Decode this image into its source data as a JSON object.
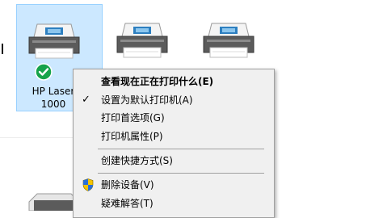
{
  "printers": [
    {
      "label_line1": "HP Laser",
      "label_line2": "1000",
      "selected": true,
      "is_default": true
    },
    {
      "label_line1": "",
      "label_line2": "",
      "selected": false,
      "is_default": false
    },
    {
      "label_line1": "",
      "label_line2": "",
      "selected": false,
      "is_default": false
    }
  ],
  "context_menu": {
    "items": [
      {
        "label": "查看现在正在打印什么(E)",
        "bold": true,
        "checked": false,
        "icon": null
      },
      {
        "label": "设置为默认打印机(A)",
        "bold": false,
        "checked": true,
        "icon": null
      },
      {
        "label": "打印首选项(G)",
        "bold": false,
        "checked": false,
        "icon": null
      },
      {
        "label": "打印机属性(P)",
        "bold": false,
        "checked": false,
        "icon": null
      },
      {
        "label": "创建快捷方式(S)",
        "bold": false,
        "checked": false,
        "icon": null
      },
      {
        "label": "删除设备(V)",
        "bold": false,
        "checked": false,
        "icon": "uac-shield-icon"
      },
      {
        "label": "疑难解答(T)",
        "bold": false,
        "checked": false,
        "icon": null
      }
    ],
    "check_glyph": "✓"
  },
  "colors": {
    "selection_bg": "#cce8ff",
    "selection_border": "#99d1ff",
    "menu_bg": "#f0f0f0",
    "default_badge": "#16a34a"
  }
}
